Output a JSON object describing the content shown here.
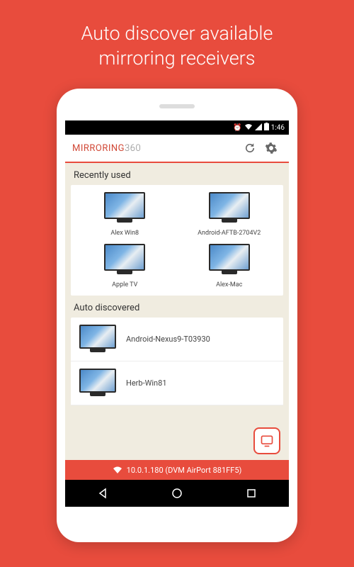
{
  "headline_line1": "Auto discover available",
  "headline_line2": "mirroring receivers",
  "status": {
    "time": "1:46"
  },
  "app": {
    "title_part1": "MIRRORING",
    "title_part2": "360"
  },
  "sections": {
    "recent_header": "Recently used",
    "discovered_header": "Auto discovered"
  },
  "recent": [
    {
      "label": "Alex Win8"
    },
    {
      "label": "Android-AFTB-2704V2"
    },
    {
      "label": "Apple TV"
    },
    {
      "label": "Alex-Mac"
    }
  ],
  "discovered": [
    {
      "label": "Android-Nexus9-T03930"
    },
    {
      "label": "Herb-Win81"
    }
  ],
  "network": {
    "text": "10.0.1.180 (DVM AirPort 881FF5)"
  }
}
